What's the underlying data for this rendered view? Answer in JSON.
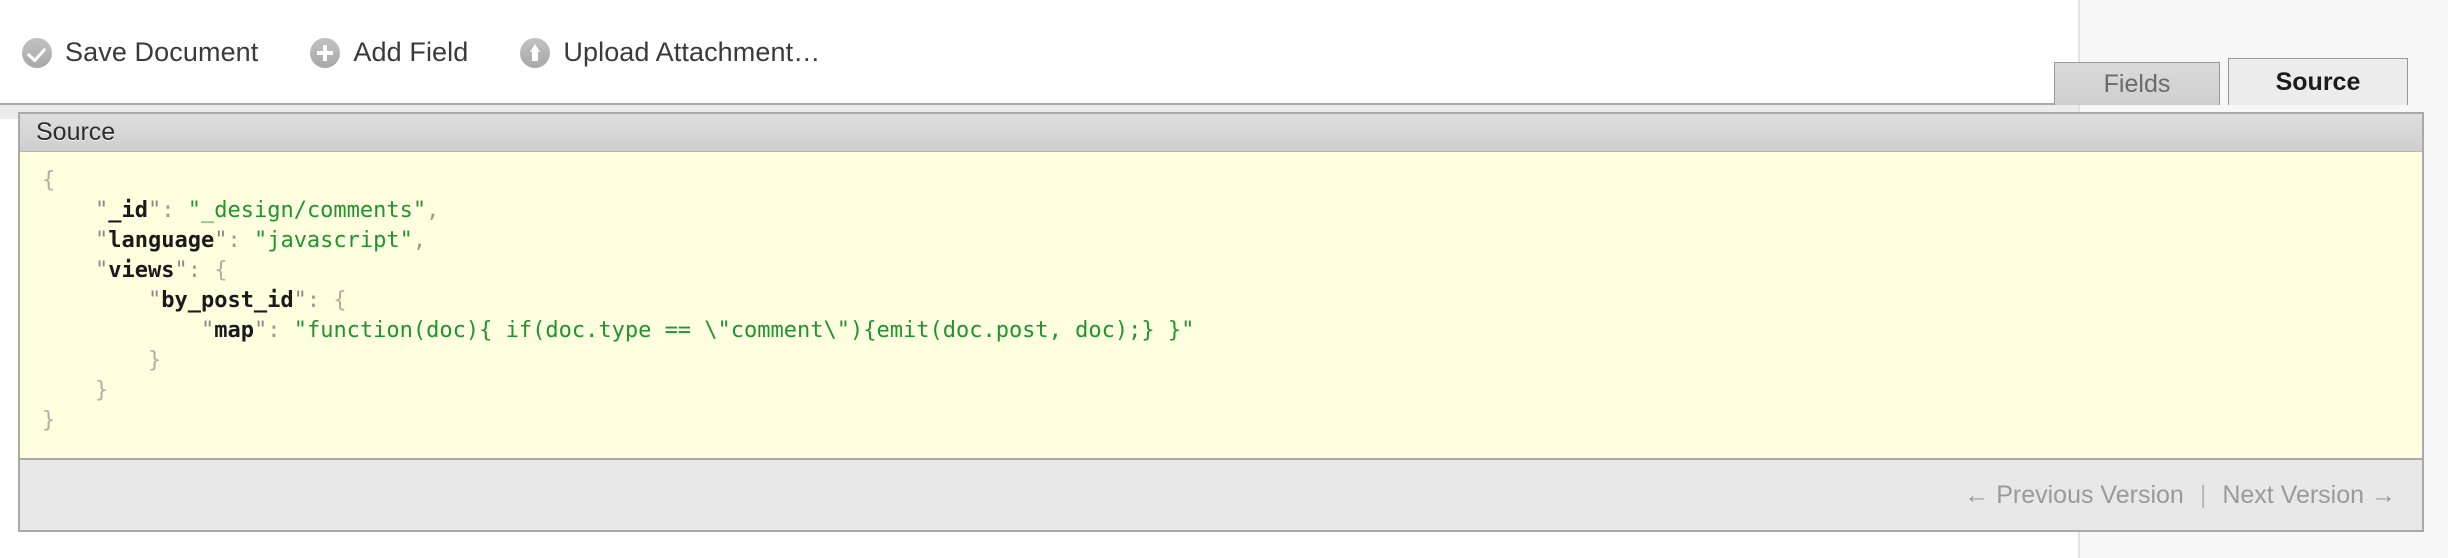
{
  "toolbar": {
    "buttons": [
      {
        "id": "save-document",
        "label": "Save Document",
        "icon": "check-circle-icon"
      },
      {
        "id": "add-field",
        "label": "Add Field",
        "icon": "plus-circle-icon"
      },
      {
        "id": "upload-attachment",
        "label": "Upload Attachment…",
        "icon": "upload-circle-icon"
      }
    ]
  },
  "tabs": [
    {
      "id": "fields",
      "label": "Fields",
      "active": false
    },
    {
      "id": "source",
      "label": "Source",
      "active": true
    }
  ],
  "panel": {
    "header_title": "Source",
    "background_color": "#ffffe0",
    "footer": {
      "previous_label": "← Previous Version",
      "separator": "|",
      "next_label": "Next Version →"
    }
  },
  "source": {
    "raw": "{\n    \"_id\": \"_design/comments\",\n    \"language\": \"javascript\",\n    \"views\": {\n        \"by_post_id\": {\n            \"map\": \"function(doc){ if(doc.type == \\\"comment\\\"){emit(doc.post, doc);} }\"\n        }\n    }\n}",
    "document": {
      "_id": "_design/comments",
      "language": "javascript",
      "views": {
        "by_post_id": {
          "map": "function(doc){ if(doc.type == \\\"comment\\\"){emit(doc.post, doc);} }"
        }
      }
    },
    "lines": [
      {
        "indent": 0,
        "tokens": [
          {
            "t": "brace",
            "v": "{"
          }
        ]
      },
      {
        "indent": 1,
        "tokens": [
          {
            "t": "q",
            "v": "\""
          },
          {
            "t": "key",
            "v": "_id"
          },
          {
            "t": "q",
            "v": "\""
          },
          {
            "t": "punct",
            "v": ": "
          },
          {
            "t": "str",
            "v": "\"_design/comments\""
          },
          {
            "t": "punct",
            "v": ","
          }
        ]
      },
      {
        "indent": 1,
        "tokens": [
          {
            "t": "q",
            "v": "\""
          },
          {
            "t": "key",
            "v": "language"
          },
          {
            "t": "q",
            "v": "\""
          },
          {
            "t": "punct",
            "v": ": "
          },
          {
            "t": "str",
            "v": "\"javascript\""
          },
          {
            "t": "punct",
            "v": ","
          }
        ]
      },
      {
        "indent": 1,
        "tokens": [
          {
            "t": "q",
            "v": "\""
          },
          {
            "t": "key",
            "v": "views"
          },
          {
            "t": "q",
            "v": "\""
          },
          {
            "t": "punct",
            "v": ": "
          },
          {
            "t": "brace",
            "v": "{"
          }
        ]
      },
      {
        "indent": 2,
        "tokens": [
          {
            "t": "q",
            "v": "\""
          },
          {
            "t": "key",
            "v": "by_post_id"
          },
          {
            "t": "q",
            "v": "\""
          },
          {
            "t": "punct",
            "v": ": "
          },
          {
            "t": "brace",
            "v": "{"
          }
        ]
      },
      {
        "indent": 3,
        "tokens": [
          {
            "t": "q",
            "v": "\""
          },
          {
            "t": "key",
            "v": "map"
          },
          {
            "t": "q",
            "v": "\""
          },
          {
            "t": "punct",
            "v": ": "
          },
          {
            "t": "str",
            "v": "\"function(doc){ if(doc.type == \\\"comment\\\"){emit(doc.post, doc);} }\""
          }
        ]
      },
      {
        "indent": 2,
        "tokens": [
          {
            "t": "brace",
            "v": "}"
          }
        ]
      },
      {
        "indent": 1,
        "tokens": [
          {
            "t": "brace",
            "v": "}"
          }
        ]
      },
      {
        "indent": 0,
        "tokens": [
          {
            "t": "brace",
            "v": "}"
          }
        ]
      }
    ]
  }
}
